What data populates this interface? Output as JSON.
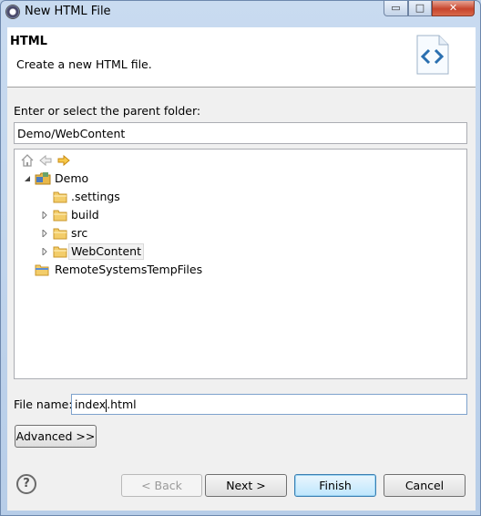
{
  "window": {
    "title": "New HTML File",
    "controls": {
      "minimize": "▭",
      "maximize": "□",
      "close": "✕"
    }
  },
  "banner": {
    "title": "HTML",
    "description": "Create a new HTML file.",
    "icon": "html-tags-icon"
  },
  "parent_folder": {
    "label": "Enter or select the parent folder:",
    "value": "Demo/WebContent"
  },
  "tree": {
    "toolbar": [
      "home-icon",
      "back-icon",
      "forward-icon"
    ],
    "items": [
      {
        "label": "Demo",
        "icon": "project-icon",
        "twisty": "expanded"
      },
      {
        "label": ".settings",
        "icon": "folder-icon",
        "twisty": "none"
      },
      {
        "label": "build",
        "icon": "folder-icon",
        "twisty": "collapsed"
      },
      {
        "label": "src",
        "icon": "folder-icon",
        "twisty": "collapsed"
      },
      {
        "label": "WebContent",
        "icon": "folder-icon",
        "twisty": "collapsed",
        "selected": true
      },
      {
        "label": "RemoteSystemsTempFiles",
        "icon": "project-folder-icon",
        "twisty": "none"
      }
    ]
  },
  "file_name": {
    "label": "File name:",
    "value_before_caret": "index",
    "value_after_caret": ".html"
  },
  "buttons": {
    "advanced": "Advanced >>",
    "back": "< Back",
    "next": "Next >",
    "finish": "Finish",
    "cancel": "Cancel",
    "help": "?"
  },
  "colors": {
    "accent": "#3c7fb1",
    "folder": "#e8b84a",
    "forward_arrow": "#e1a21a"
  }
}
